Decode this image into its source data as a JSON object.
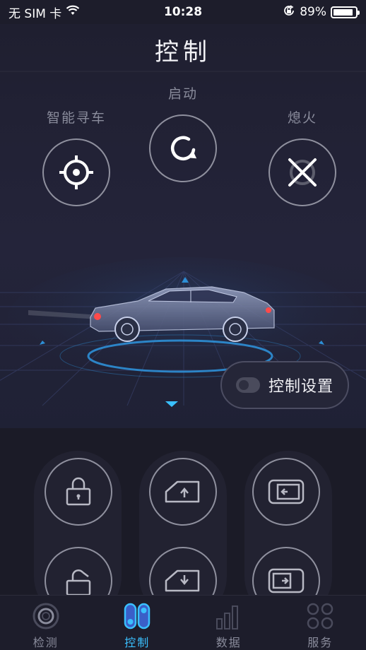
{
  "status_bar": {
    "carrier": "无 SIM 卡",
    "time": "10:28",
    "battery_percent": "89%",
    "battery_level": 0.89
  },
  "page": {
    "title": "控制"
  },
  "remote_controls": {
    "find_car_label": "智能寻车",
    "start_label": "启动",
    "engine_off_label": "熄火"
  },
  "settings": {
    "label": "控制设置",
    "toggle_on": false
  },
  "actions": [
    {
      "icon": "lock-icon"
    },
    {
      "icon": "window-up-icon"
    },
    {
      "icon": "door-close-icon"
    },
    {
      "icon": "unlock-icon"
    },
    {
      "icon": "window-down-icon"
    },
    {
      "icon": "door-open-icon"
    }
  ],
  "tabs": [
    {
      "label": "检测",
      "icon": "detect-icon",
      "active": false
    },
    {
      "label": "控制",
      "icon": "control-icon",
      "active": true
    },
    {
      "label": "数据",
      "icon": "data-icon",
      "active": false
    },
    {
      "label": "服务",
      "icon": "service-icon",
      "active": false
    }
  ],
  "colors": {
    "accent": "#3ac0ff",
    "background": "#1d1d2b",
    "ring": "#8f909e"
  }
}
